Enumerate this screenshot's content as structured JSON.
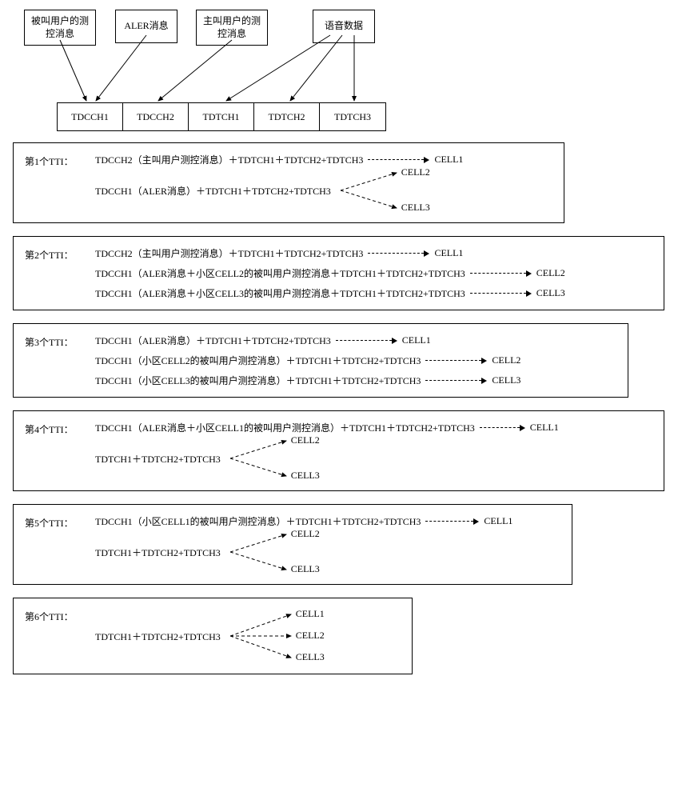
{
  "sources": {
    "called": "被叫用户的测\n控消息",
    "aler": "ALER消息",
    "caller": "主叫用户的测\n控消息",
    "voice": "语音数据"
  },
  "channels": [
    "TDCCH1",
    "TDCCH2",
    "TDTCH1",
    "TDTCH2",
    "TDTCH3"
  ],
  "tti": [
    {
      "label": "第1个TTI：",
      "lines": [
        {
          "expr": "TDCCH2（主叫用户测控消息）＋TDTCH1＋TDTCH2+TDTCH3",
          "target": "CELL1",
          "dash": 70
        },
        {
          "expr": "TDCCH1（ALER消息）＋TDTCH1＋TDTCH2+TDTCH3",
          "fork2": [
            "CELL2",
            "CELL3"
          ]
        }
      ]
    },
    {
      "label": "第2个TTI：",
      "lines": [
        {
          "expr": "TDCCH2（主叫用户测控消息）＋TDTCH1＋TDTCH2+TDTCH3",
          "target": "CELL1",
          "dash": 70
        },
        {
          "expr": "TDCCH1（ALER消息＋小区CELL2的被叫用户测控消息＋TDTCH1＋TDTCH2+TDTCH3",
          "target": "CELL2",
          "dash": 70
        },
        {
          "expr": "TDCCH1（ALER消息＋小区CELL3的被叫用户测控消息＋TDTCH1＋TDTCH2+TDTCH3",
          "target": "CELL3",
          "dash": 70
        }
      ]
    },
    {
      "label": "第3个TTI：",
      "lines": [
        {
          "expr": "TDCCH1（ALER消息）＋TDTCH1＋TDTCH2+TDTCH3",
          "target": "CELL1",
          "dash": 70
        },
        {
          "expr": "TDCCH1（小区CELL2的被叫用户测控消息）＋TDTCH1＋TDTCH2+TDTCH3",
          "target": "CELL2",
          "dash": 70
        },
        {
          "expr": "TDCCH1（小区CELL3的被叫用户测控消息）＋TDTCH1＋TDTCH2+TDTCH3",
          "target": "CELL3",
          "dash": 70
        }
      ]
    },
    {
      "label": "第4个TTI：",
      "lines": [
        {
          "expr": "TDCCH1（ALER消息＋小区CELL1的被叫用户测控消息）＋TDTCH1＋TDTCH2+TDTCH3",
          "target": "CELL1",
          "dash": 50
        },
        {
          "expr": "TDTCH1＋TDTCH2+TDTCH3",
          "fork2": [
            "CELL2",
            "CELL3"
          ]
        }
      ]
    },
    {
      "label": "第5个TTI：",
      "lines": [
        {
          "expr": "TDCCH1（小区CELL1的被叫用户测控消息）＋TDTCH1＋TDTCH2+TDTCH3",
          "target": "CELL1",
          "dash": 60
        },
        {
          "expr": "TDTCH1＋TDTCH2+TDTCH3",
          "fork2": [
            "CELL2",
            "CELL3"
          ]
        }
      ]
    },
    {
      "label": "第6个TTI：",
      "lines": [
        {
          "expr": "TDTCH1＋TDTCH2+TDTCH3",
          "fork3": [
            "CELL1",
            "CELL2",
            "CELL3"
          ]
        }
      ]
    }
  ]
}
